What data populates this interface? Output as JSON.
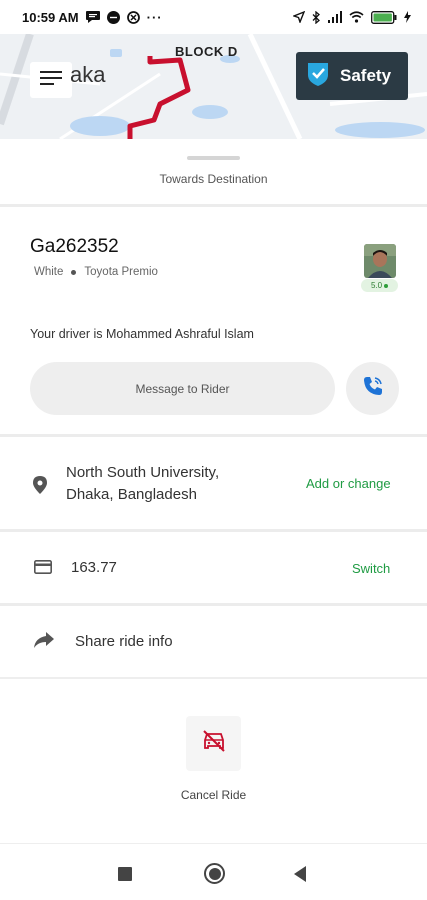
{
  "status_bar": {
    "time": "10:59 AM",
    "dots": "···",
    "battery": "100"
  },
  "map": {
    "city_label": "aka",
    "block_label": "BLOCK D",
    "safety_label": "Safety",
    "route_color": "#c8102e"
  },
  "sheet": {
    "towards_label": "Towards Destination"
  },
  "driver": {
    "plate": "Ga262352",
    "car_color": "White",
    "car_model": "Toyota Premio",
    "rating": "5.0",
    "intro_text": "Your driver is Mohammed Ashraful Islam"
  },
  "actions": {
    "message_label": "Message to Rider"
  },
  "destination": {
    "line1": "North South University,",
    "line2": "Dhaka, Bangladesh",
    "change_label": "Add or change"
  },
  "payment": {
    "fare": "163.77",
    "switch_label": "Switch"
  },
  "share": {
    "label": "Share ride info"
  },
  "cancel": {
    "label": "Cancel Ride"
  },
  "colors": {
    "accent_green": "#1f9b43",
    "safety_bg": "#2b3a44",
    "safety_icon": "#29a7df"
  }
}
